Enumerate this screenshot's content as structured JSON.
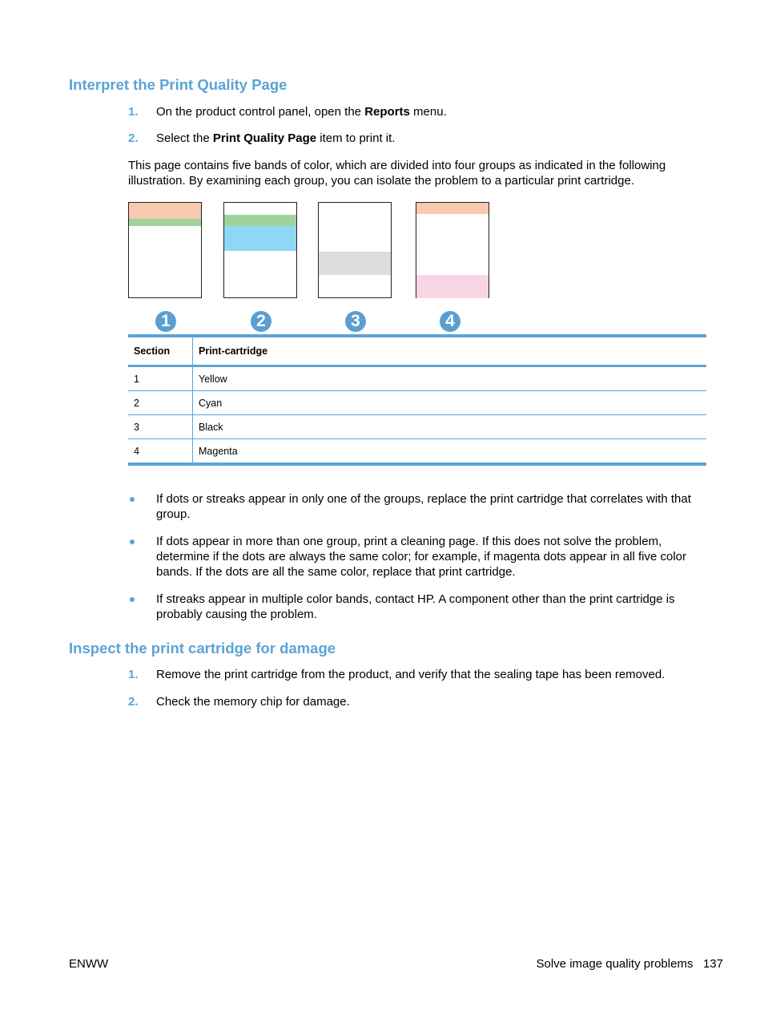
{
  "section1": {
    "heading": "Interpret the Print Quality Page",
    "steps": [
      {
        "num": "1.",
        "pre": "On the product control panel, open the ",
        "bold": "Reports",
        "post": " menu."
      },
      {
        "num": "2.",
        "pre": "Select the ",
        "bold": "Print Quality Page",
        "post": " item to print it."
      }
    ],
    "intro": "This page contains five bands of color, which are divided into four groups as indicated in the following illustration. By examining each group, you can isolate the problem to a particular print cartridge.",
    "illustration": {
      "groups": [
        {
          "callout": "1",
          "bands": [
            "#f9c8b0",
            "#a0d39c"
          ]
        },
        {
          "callout": "2",
          "bands": [
            "#a0d39c",
            "#8dd7f7"
          ]
        },
        {
          "callout": "3",
          "bands": [
            "#dcdddf"
          ]
        },
        {
          "callout": "4",
          "bands": [
            "#f9c8b0",
            "#f8d5e5"
          ]
        }
      ]
    },
    "table": {
      "headers": [
        "Section",
        "Print-cartridge"
      ],
      "rows": [
        [
          "1",
          "Yellow"
        ],
        [
          "2",
          "Cyan"
        ],
        [
          "3",
          "Black"
        ],
        [
          "4",
          "Magenta"
        ]
      ]
    },
    "bullets": [
      "If dots or streaks appear in only one of the groups, replace the print cartridge that correlates with that group.",
      "If dots appear in more than one group, print a cleaning page. If this does not solve the problem, determine if the dots are always the same color; for example, if magenta dots appear in all five color bands. If the dots are all the same color, replace that print cartridge.",
      "If streaks appear in multiple color bands, contact HP. A component other than the print cartridge is probably causing the problem."
    ]
  },
  "section2": {
    "heading": "Inspect the print cartridge for damage",
    "steps": [
      {
        "num": "1.",
        "text": "Remove the print cartridge from the product, and verify that the sealing tape has been removed."
      },
      {
        "num": "2.",
        "text": "Check the memory chip for damage."
      }
    ]
  },
  "footer": {
    "left": "ENWW",
    "right_title": "Solve image quality problems",
    "page_number": "137"
  },
  "colors": {
    "accent": "#5ba3d6"
  }
}
